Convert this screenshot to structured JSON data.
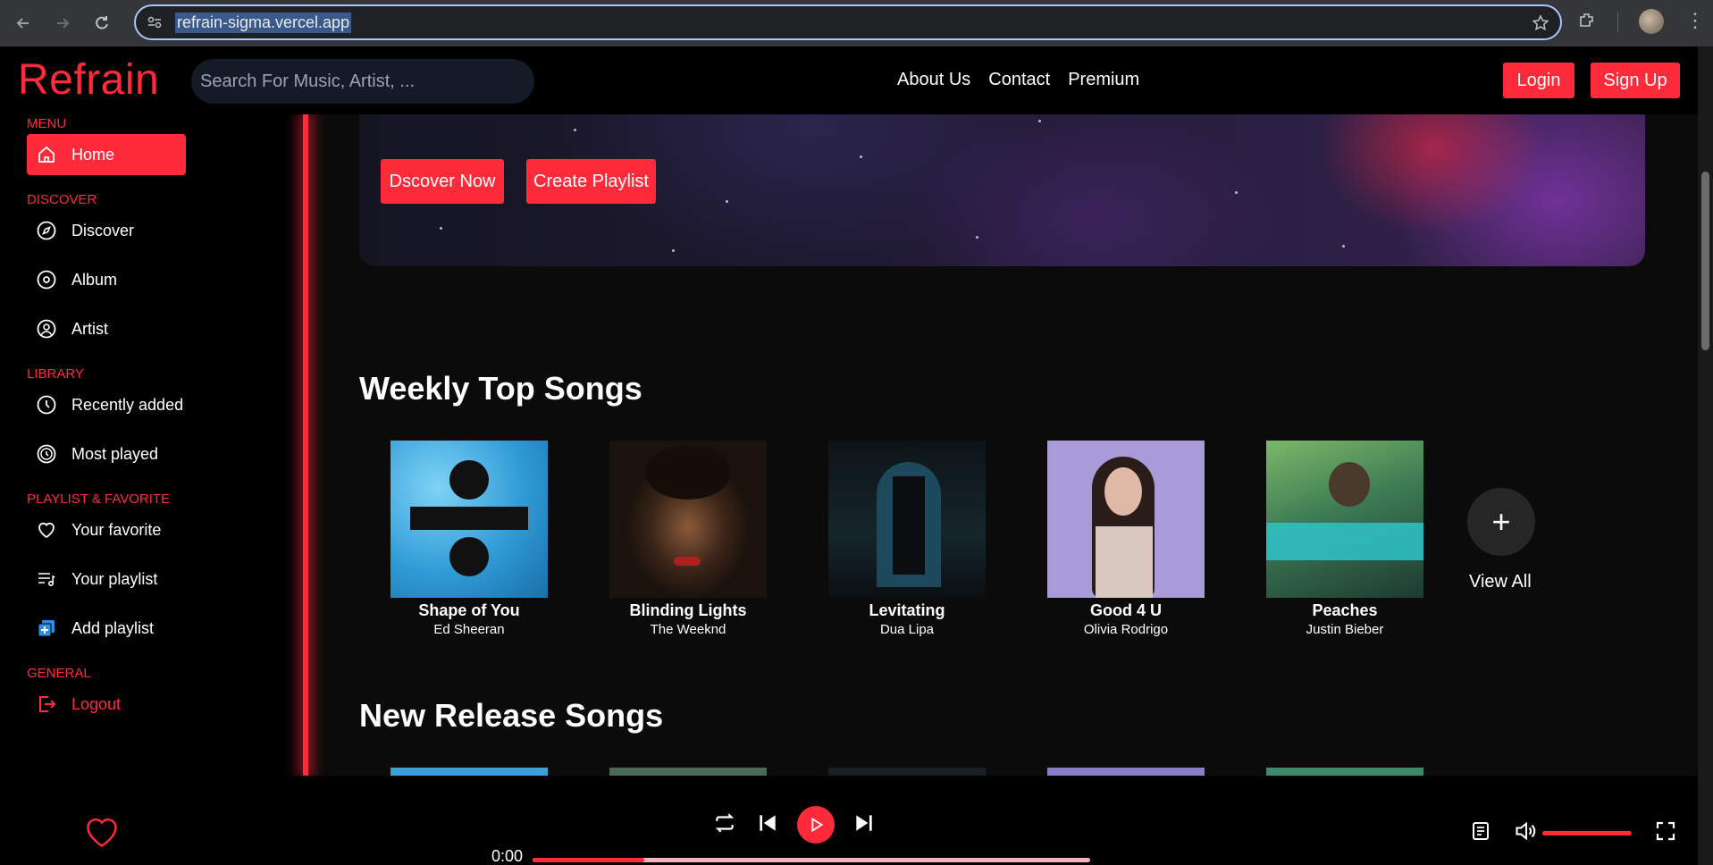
{
  "browser": {
    "url": "refrain-sigma.vercel.app"
  },
  "header": {
    "logo": "Refrain",
    "search_placeholder": "Search For Music, Artist, ...",
    "links": [
      "About Us",
      "Contact",
      "Premium"
    ],
    "login": "Login",
    "signup": "Sign Up"
  },
  "sidebar": {
    "menu_title": "MENU",
    "home": "Home",
    "discover_title": "DISCOVER",
    "discover": "Discover",
    "album": "Album",
    "artist": "Artist",
    "library_title": "LIBRARY",
    "recently_added": "Recently added",
    "most_played": "Most played",
    "playlist_title": "PLAYLIST & FAVORITE",
    "your_favorite": "Your favorite",
    "your_playlist": "Your playlist",
    "add_playlist": "Add playlist",
    "general_title": "GENERAL",
    "logout": "Logout"
  },
  "hero": {
    "discover_button": "Dscover Now",
    "playlist_button": "Create Playlist"
  },
  "weekly": {
    "title": "Weekly Top Songs",
    "songs": [
      {
        "title": "Shape of You",
        "artist": "Ed Sheeran"
      },
      {
        "title": "Blinding Lights",
        "artist": "The Weeknd"
      },
      {
        "title": "Levitating",
        "artist": "Dua Lipa"
      },
      {
        "title": "Good 4 U",
        "artist": "Olivia Rodrigo"
      },
      {
        "title": "Peaches",
        "artist": "Justin Bieber"
      }
    ],
    "view_all": "View All"
  },
  "new_release": {
    "title": "New Release Songs"
  },
  "player": {
    "current_time": "0:00",
    "progress_fraction": 0.2,
    "volume_fraction": 1.0
  }
}
